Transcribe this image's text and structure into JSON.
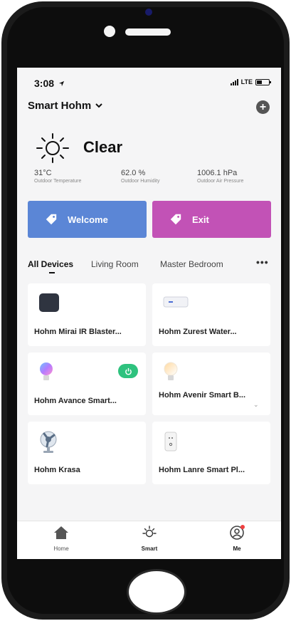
{
  "status_bar": {
    "time": "3:08",
    "carrier": "LTE"
  },
  "header": {
    "home_name": "Smart Hohm"
  },
  "weather": {
    "condition": "Clear",
    "metrics": [
      {
        "value": "31°C",
        "label": "Outdoor Temperature"
      },
      {
        "value": "62.0 %",
        "label": "Outdoor Humidity"
      },
      {
        "value": "1006.1 hPa",
        "label": "Outdoor Air Pressure"
      }
    ]
  },
  "scenes": [
    {
      "label": "Welcome",
      "color": "#5b86d6"
    },
    {
      "label": "Exit",
      "color": "#c252b6"
    }
  ],
  "tabs": [
    "All Devices",
    "Living Room",
    "Master Bedroom"
  ],
  "devices": [
    {
      "name": "Hohm Mirai IR Blaster...",
      "icon": "ir-blaster-icon"
    },
    {
      "name": "Hohm Zurest  Water...",
      "icon": "water-heater-icon"
    },
    {
      "name": "Hohm Avance Smart...",
      "icon": "rgb-bulb-icon",
      "power": "on"
    },
    {
      "name": "Hohm Avenir Smart B...",
      "icon": "bulb-icon"
    },
    {
      "name": "Hohm Krasa",
      "icon": "fan-icon"
    },
    {
      "name": "Hohm Lanre Smart Pl...",
      "icon": "smart-plug-icon"
    }
  ],
  "tabbar": [
    {
      "label": "Home",
      "icon": "home-icon"
    },
    {
      "label": "Smart",
      "icon": "sun-icon"
    },
    {
      "label": "Me",
      "icon": "user-icon"
    }
  ],
  "colors": {
    "accent_green": "#2ec27e",
    "welcome": "#5b86d6",
    "exit": "#c252b6"
  }
}
